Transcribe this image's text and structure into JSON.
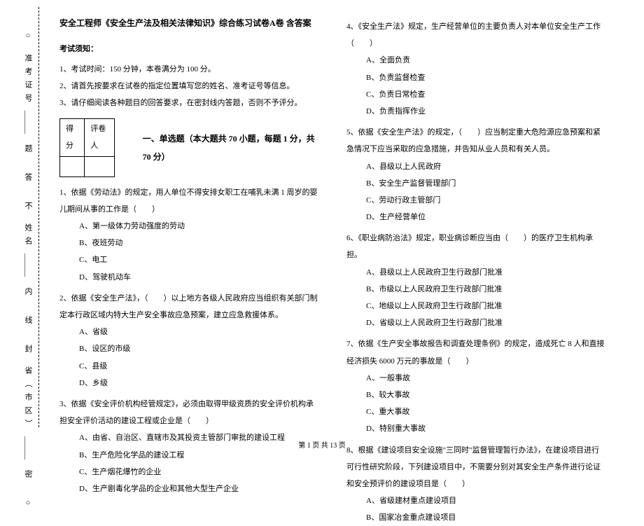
{
  "side": {
    "circle": "○",
    "labels": {
      "province": "省（市区）",
      "name": "姓名",
      "admission": "准考证号"
    },
    "seal_chars": [
      "密",
      "封",
      "线",
      "内",
      "不",
      "答",
      "题"
    ],
    "underline": "______"
  },
  "header": {
    "title": "安全工程师《安全生产法及相关法律知识》综合练习试卷A卷 含答案",
    "notice_label": "考试须知：",
    "notices": [
      "1、考试时间：150 分钟，本卷满分为 100 分。",
      "2、请首先按要求在试卷的指定位置填写您的姓名、准考证号等信息。",
      "3、请仔细阅读各种题目的回答要求，在密封线内答题，否则不予评分。"
    ],
    "score_labels": {
      "score": "得分",
      "reviewer": "评卷人"
    },
    "section1": "一、单选题（本大题共 70 小题，每题 1 分，共 70 分）"
  },
  "ql": [
    {
      "stem": "1、依据《劳动法》的规定，用人单位不得安排女职工在哺乳未满 1 周岁的婴儿期间从事的工作是（　　）",
      "opts": [
        "A、第一级体力劳动强度的劳动",
        "B、夜班劳动",
        "C、电工",
        "D、驾驶机动车"
      ]
    },
    {
      "stem": "2、依据《安全生产法》，（　　）以上地方各级人民政府应当组织有关部门制定本行政区域内特大生产安全事故应急预案，建立应急救援体系。",
      "opts": [
        "A、省级",
        "B、设区的市级",
        "C、县级",
        "D、乡级"
      ]
    },
    {
      "stem": "3、依据《安全评价机构经管规定》，必须由取得甲级资质的安全评价机构承担安全评价活动的建设工程或企业是（　　）",
      "opts": [
        "A、由省、自治区、直辖市及其投资主管部门审批的建设工程",
        "B、生产危险化学品的建设工程",
        "C、生产烟花爆竹的企业",
        "D、生产剧毒化学品的企业和其他大型生产企业"
      ]
    }
  ],
  "qr": [
    {
      "stem": "4、《安全生产法》规定，生产经营单位的主要负责人对本单位安全生产工作（　　）",
      "opts": [
        "A、全面负责",
        "B、负责监督检查",
        "C、负责日常检查",
        "D、负责指挥作业"
      ]
    },
    {
      "stem": "5、依据《安全生产法》的规定，（　　）应当制定重大危险源应急预案和紧急情况下应当采取的应急措施，并告知从业人员和有关人员。",
      "opts": [
        "A、县级以上人民政府",
        "B、安全生产监督管理部门",
        "C、劳动行政主管部门",
        "D、生产经营单位"
      ]
    },
    {
      "stem": "6、《职业病防治法》规定，职业病诊断应当由（　　）的医疗卫生机构承担。",
      "opts": [
        "A、县级以上人民政府卫生行政部门批准",
        "B、市级以上人民政府卫生行政部门批准",
        "C、地级以上人民政府卫生行政部门批准",
        "D、省级以上人民政府卫生行政部门批准"
      ]
    },
    {
      "stem": "7、依据《生产安全事故报告和调查处理条例》的规定，造成死亡 8 人和直接经济损失 6000 万元的事故是（　　）",
      "opts": [
        "A、一般事故",
        "B、较大事故",
        "C、重大事故",
        "D、特别重大事故"
      ]
    },
    {
      "stem": "8、根据《建设项目安全设施\"三同时\"监督管理暂行办法》，在建设项目进行可行性研究阶段，下列建设项目中，不需要分别对其安全生产条件进行论证和安全预评价的建设项目是（　　）",
      "opts": [
        "A、省级建材重点建设项目",
        "B、国家冶金重点建设项目"
      ]
    }
  ],
  "footer": "第 1 页 共 13 页"
}
